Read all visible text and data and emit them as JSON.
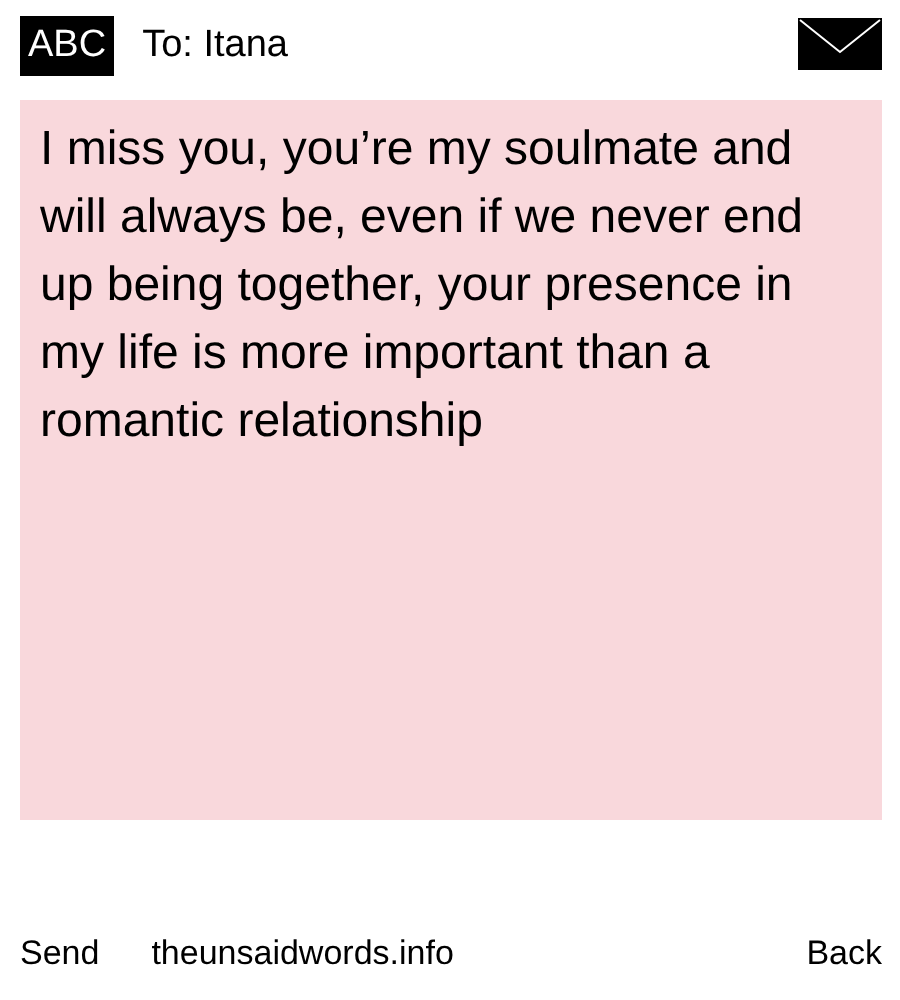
{
  "header": {
    "mode": "ABC",
    "recipient": "To: Itana"
  },
  "message": {
    "value": "I miss you, you’re my soulmate and will always be, even if we never end up being together, your presence in my life is more important than a romantic relationship"
  },
  "footer": {
    "left": "Send",
    "site": "theunsaidwords.info",
    "right": "Back"
  }
}
